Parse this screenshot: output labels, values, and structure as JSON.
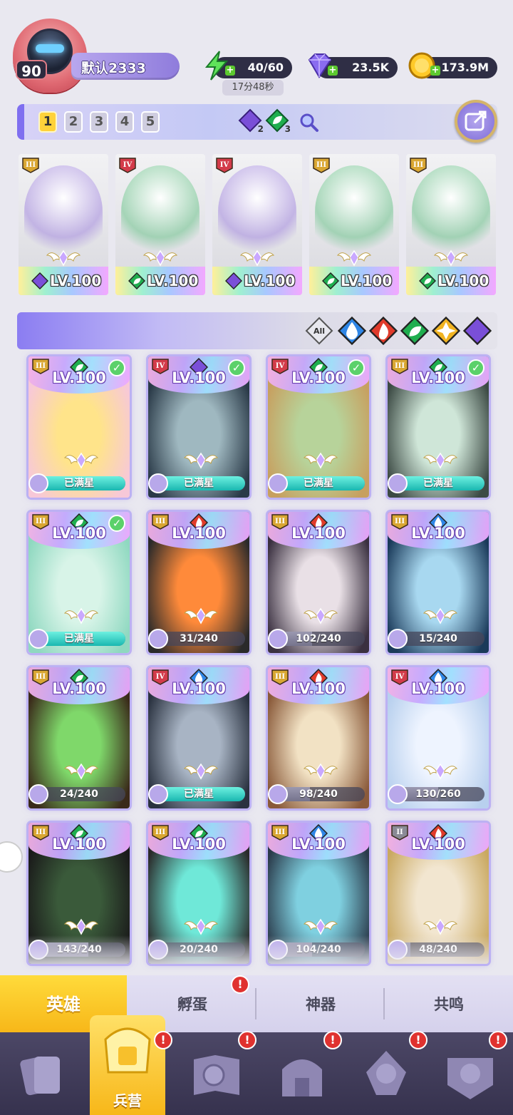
{
  "player": {
    "level": "90",
    "name": "默认2333"
  },
  "resources": {
    "energy": "40/60",
    "energy_timer": "17分48秒",
    "gems": "23.5K",
    "gold": "173.9M"
  },
  "team_tabs": [
    "1",
    "2",
    "3",
    "4",
    "5"
  ],
  "team_indicators": [
    {
      "icon": "moon-element-icon",
      "count": "2",
      "color": "#7a4fd8"
    },
    {
      "icon": "leaf-element-icon",
      "count": "3",
      "color": "#1fae4f"
    }
  ],
  "team_slots": [
    {
      "rank": "III",
      "element": "moon",
      "level": "LV.100"
    },
    {
      "rank": "IV",
      "element": "leaf",
      "level": "LV.100"
    },
    {
      "rank": "IV",
      "element": "moon",
      "level": "LV.100"
    },
    {
      "rank": "III",
      "element": "leaf",
      "level": "LV.100"
    },
    {
      "rank": "III",
      "element": "leaf",
      "level": "LV.100"
    }
  ],
  "filters": [
    {
      "label": "All",
      "icon": "all-filter-icon"
    },
    {
      "icon": "water-element-icon",
      "color": "#2f86e6"
    },
    {
      "icon": "fire-element-icon",
      "color": "#e03b2b"
    },
    {
      "icon": "leaf-element-icon",
      "color": "#1fae4f"
    },
    {
      "icon": "light-element-icon",
      "color": "#f0b321"
    },
    {
      "icon": "moon-element-icon",
      "color": "#7a4fd8"
    }
  ],
  "heroes": [
    {
      "rank": "III",
      "element": "leaf",
      "level": "LV.100",
      "progress": "已满星",
      "fill": 1,
      "checked": true,
      "palette": [
        "#ffe48a",
        "#f7c8d8"
      ]
    },
    {
      "rank": "IV",
      "element": "moon",
      "level": "LV.100",
      "progress": "已满星",
      "fill": 1,
      "checked": true,
      "palette": [
        "#9fb8c0",
        "#2a3a48"
      ]
    },
    {
      "rank": "IV",
      "element": "leaf",
      "level": "LV.100",
      "progress": "已满星",
      "fill": 1,
      "checked": true,
      "palette": [
        "#b7d39a",
        "#c7a060"
      ]
    },
    {
      "rank": "III",
      "element": "leaf",
      "level": "LV.100",
      "progress": "已满星",
      "fill": 1,
      "checked": true,
      "palette": [
        "#cfe6d8",
        "#3c4a44"
      ]
    },
    {
      "rank": "III",
      "element": "leaf",
      "level": "LV.100",
      "progress": "已满星",
      "fill": 1,
      "checked": true,
      "palette": [
        "#d8f4e8",
        "#8fd8c0"
      ]
    },
    {
      "rank": "III",
      "element": "fire",
      "level": "LV.100",
      "progress": "31/240",
      "fill": 0.13,
      "checked": false,
      "palette": [
        "#ff8a3a",
        "#2a2a2a"
      ]
    },
    {
      "rank": "III",
      "element": "fire",
      "level": "LV.100",
      "progress": "102/240",
      "fill": 0.43,
      "checked": false,
      "palette": [
        "#e9e0e6",
        "#3a3040"
      ]
    },
    {
      "rank": "III",
      "element": "water",
      "level": "LV.100",
      "progress": "15/240",
      "fill": 0.06,
      "checked": false,
      "palette": [
        "#a8d8f0",
        "#1a3a5a"
      ]
    },
    {
      "rank": "III",
      "element": "leaf",
      "level": "LV.100",
      "progress": "24/240",
      "fill": 0.1,
      "checked": false,
      "palette": [
        "#7fd86a",
        "#3a2a1a"
      ]
    },
    {
      "rank": "IV",
      "element": "water",
      "level": "LV.100",
      "progress": "已满星",
      "fill": 1,
      "checked": false,
      "palette": [
        "#a8b4c4",
        "#2a3240"
      ]
    },
    {
      "rank": "III",
      "element": "fire",
      "level": "LV.100",
      "progress": "98/240",
      "fill": 0.41,
      "checked": false,
      "palette": [
        "#f2e2c4",
        "#8a5a3a"
      ]
    },
    {
      "rank": "IV",
      "element": "water",
      "level": "LV.100",
      "progress": "130/260",
      "fill": 0.5,
      "checked": false,
      "palette": [
        "#eef4ff",
        "#b8d0ee"
      ]
    },
    {
      "rank": "III",
      "element": "leaf",
      "level": "LV.100",
      "progress": "143/240",
      "fill": 0.6,
      "checked": false,
      "palette": [
        "#3a5a3a",
        "#1a1a1a"
      ]
    },
    {
      "rank": "III",
      "element": "leaf",
      "level": "LV.100",
      "progress": "20/240",
      "fill": 0.08,
      "checked": false,
      "palette": [
        "#6fe8d8",
        "#2a2a2a"
      ]
    },
    {
      "rank": "III",
      "element": "water",
      "level": "LV.100",
      "progress": "104/240",
      "fill": 0.43,
      "checked": false,
      "palette": [
        "#7fd0e0",
        "#2a3a4a"
      ]
    },
    {
      "rank": "II",
      "element": "fire",
      "level": "LV.100",
      "progress": "48/240",
      "fill": 0.2,
      "checked": false,
      "palette": [
        "#f2e6d0",
        "#c9a860"
      ]
    }
  ],
  "sub_tabs": [
    "英雄",
    "孵蛋",
    "神器",
    "共鸣"
  ],
  "bottom_nav": {
    "active_label": "兵营"
  },
  "element_colors": {
    "moon": "#7a4fd8",
    "leaf": "#1fae4f",
    "fire": "#e03b2b",
    "water": "#2f86e6",
    "light": "#f0b321"
  }
}
